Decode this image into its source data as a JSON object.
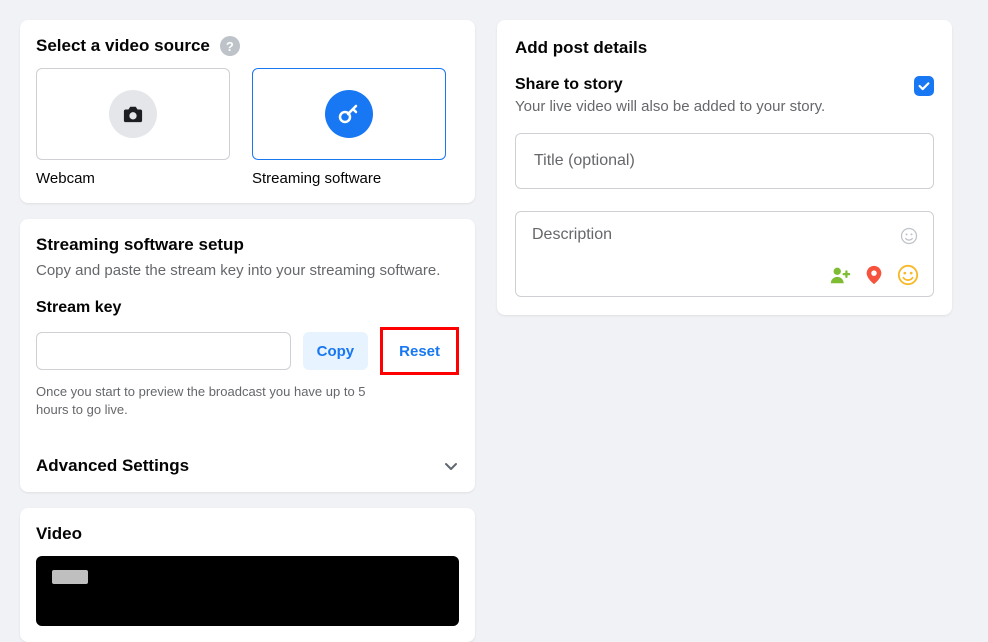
{
  "select_source": {
    "heading": "Select a video source",
    "webcam_label": "Webcam",
    "streaming_label": "Streaming software"
  },
  "setup": {
    "heading": "Streaming software setup",
    "description": "Copy and paste the stream key into your streaming software.",
    "stream_key_label": "Stream key",
    "stream_key_value": "",
    "copy_label": "Copy",
    "reset_label": "Reset",
    "hint": "Once you start to preview the broadcast you have up to 5 hours to go live.",
    "advanced_label": "Advanced Settings"
  },
  "video": {
    "heading": "Video"
  },
  "post": {
    "heading": "Add post details",
    "story_title": "Share to story",
    "story_desc": "Your live video will also be added to your story.",
    "share_checked": true,
    "title_placeholder": "Title (optional)",
    "description_placeholder": "Description"
  }
}
